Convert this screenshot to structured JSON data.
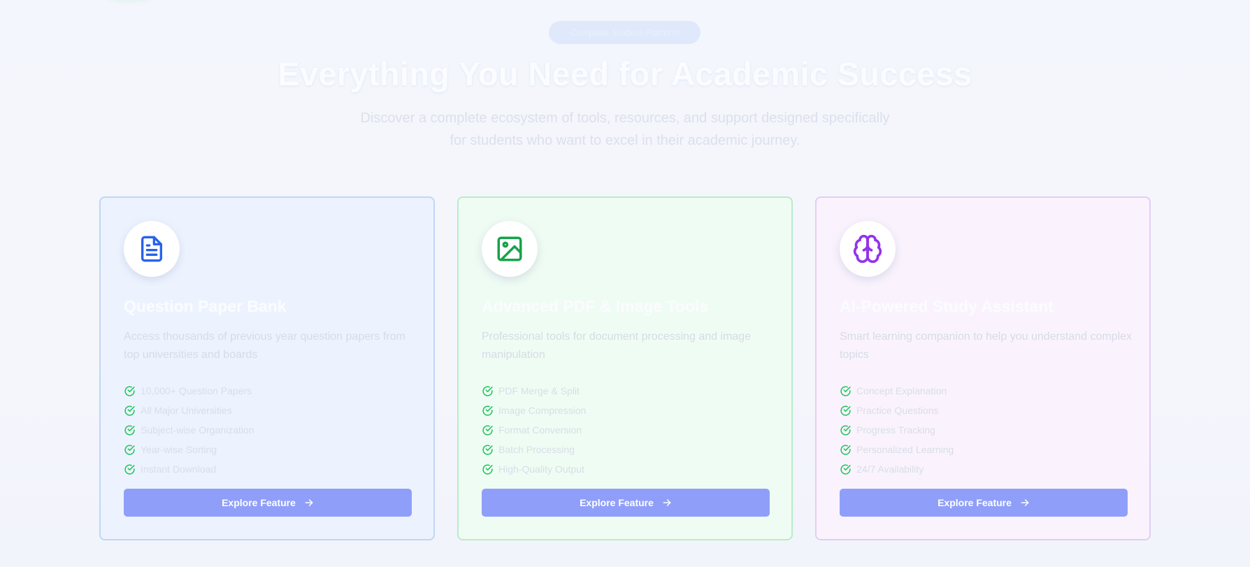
{
  "section": {
    "badge": "Complete Student Platform",
    "title": "Everything You Need for Academic Success",
    "subtitle": "Discover a complete ecosystem of tools, resources, and support designed specifically for students who want to excel in their academic journey."
  },
  "cards": [
    {
      "icon": "document-icon",
      "accent": "#2563eb",
      "title": "Question Paper Bank",
      "description": "Access thousands of previous year question papers from top universities and boards",
      "features": [
        "10,000+ Question Papers",
        "All Major Universities",
        "Subject-wise Organization",
        "Year-wise Sorting",
        "Instant Download"
      ],
      "button": "Explore Feature"
    },
    {
      "icon": "image-icon",
      "accent": "#16a34a",
      "title": "Advanced PDF & Image Tools",
      "description": "Professional tools for document processing and image manipulation",
      "features": [
        "PDF Merge & Split",
        "Image Compression",
        "Format Conversion",
        "Batch Processing",
        "High-Quality Output"
      ],
      "button": "Explore Feature"
    },
    {
      "icon": "brain-icon",
      "accent": "#9333ea",
      "title": "AI-Powered Study Assistant",
      "description": "Smart learning companion to help you understand complex topics",
      "features": [
        "Concept Explanation",
        "Practice Questions",
        "Progress Tracking",
        "Personalized Learning",
        "24/7 Availability"
      ],
      "button": "Explore Feature"
    }
  ],
  "colors": {
    "check": "#22c55e",
    "button": "#8f9ff9"
  }
}
